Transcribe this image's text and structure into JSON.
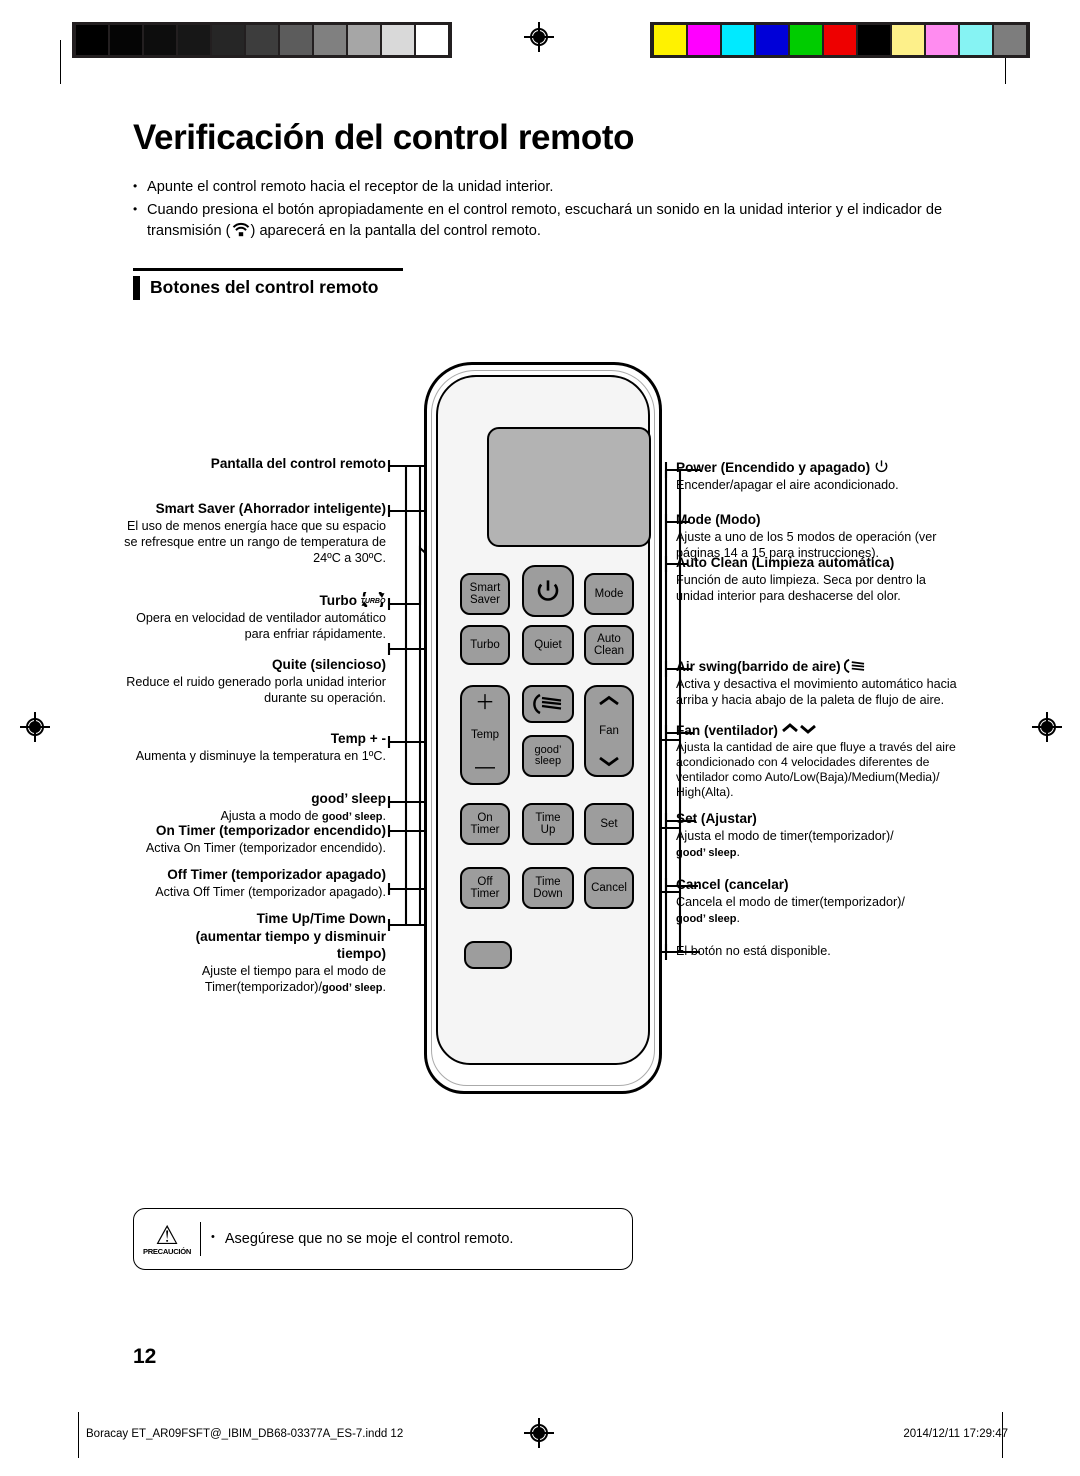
{
  "page": {
    "title": "Verificación del control remoto",
    "number": "12",
    "section_heading": "Botones del control remoto",
    "intro_bullets": [
      "Apunte el control remoto hacia el receptor de la unidad interior.",
      "Cuando presiona el botón apropiadamente en el control remoto, escuchará un sonido en la unidad interior y el indicador de transmisión (≋) aparecerá en la pantalla del control remoto."
    ],
    "intro_bullet_2_part1": "Cuando presiona el botón apropiadamente en el control remoto, escuchará un sonido en la unidad interior y el indicador de",
    "intro_bullet_2_part2": "transmisión (",
    "intro_bullet_2_part3": ") aparecerá en la pantalla del control remoto."
  },
  "calibration": {
    "gray_swatches": [
      "#000000",
      "#050505",
      "#0d0d0d",
      "#171717",
      "#262626",
      "#3d3d3d",
      "#5c5c5c",
      "#808080",
      "#a6a6a6",
      "#d9d9d9",
      "#ffffff"
    ],
    "color_swatches": [
      "#fff200",
      "#ff00ff",
      "#00eaff",
      "#0000d8",
      "#00cc00",
      "#ee0000",
      "#000000",
      "#fdf08a",
      "#ff8cf0",
      "#86f3f3",
      "#7d7d7d"
    ]
  },
  "remote": {
    "screen_label": "display",
    "buttons": [
      {
        "name": "smart-saver",
        "lines": [
          "Smart",
          "Saver"
        ]
      },
      {
        "name": "power",
        "lines": [],
        "glyph": "⏻"
      },
      {
        "name": "mode",
        "lines": [
          "Mode"
        ]
      },
      {
        "name": "turbo",
        "lines": [
          "Turbo"
        ]
      },
      {
        "name": "quiet",
        "lines": [
          "Quiet"
        ]
      },
      {
        "name": "auto-clean",
        "lines": [
          "Auto",
          "Clean"
        ]
      },
      {
        "name": "temp",
        "lines": [
          "Temp"
        ],
        "glyph_top": "＋",
        "glyph_bottom": "—"
      },
      {
        "name": "air-swing",
        "lines": []
      },
      {
        "name": "fan",
        "lines": [
          "Fan"
        ],
        "glyph_top": "⌃",
        "glyph_bottom": "⌄"
      },
      {
        "name": "good-sleep",
        "lines": [
          "good’",
          "sleep"
        ]
      },
      {
        "name": "on-timer",
        "lines": [
          "On",
          "Timer"
        ]
      },
      {
        "name": "time-up",
        "lines": [
          "Time",
          "Up"
        ]
      },
      {
        "name": "set",
        "lines": [
          "Set"
        ]
      },
      {
        "name": "off-timer",
        "lines": [
          "Off",
          "Timer"
        ]
      },
      {
        "name": "time-down",
        "lines": [
          "Time",
          "Down"
        ]
      },
      {
        "name": "cancel",
        "lines": [
          "Cancel"
        ]
      },
      {
        "name": "unavailable",
        "lines": []
      }
    ]
  },
  "left_callouts": {
    "display": {
      "heading": "Pantalla del control remoto",
      "body": ""
    },
    "smart_saver": {
      "heading": "Smart Saver (Ahorrador inteligente)",
      "body": "El uso de menos energía hace que su espacio se refresque entre un rango de temperatura de 24ºC a 30ºC."
    },
    "turbo": {
      "heading": "Turbo",
      "icon": "TURBO",
      "body": "Opera en velocidad de ventilador automático para enfriar rápidamente."
    },
    "quiet": {
      "heading": "Quite (silencioso)",
      "body": "Reduce el ruido generado porla unidad interior durante su operación."
    },
    "temp": {
      "heading": "Temp + -",
      "body": "Aumenta y disminuye la temperatura en 1ºC."
    },
    "good_sleep": {
      "heading": "good’ sleep",
      "body_pre": "Ajusta a modo de ",
      "body_bold": "good’ sleep",
      "body_post": "."
    },
    "on_timer": {
      "heading": "On Timer (temporizador encendido)",
      "body": "Activa On Timer (temporizador encendido)."
    },
    "off_timer": {
      "heading": "Off Timer (temporizador apagado)",
      "body": "Activa Off Timer (temporizador apagado)."
    },
    "time_updown": {
      "heading_l1": "Time Up/Time Down",
      "heading_l2": "(aumentar tiempo y disminuir",
      "heading_l3": "tiempo)",
      "body_l1": "Ajuste el tiempo para el modo de",
      "body_l2_pre": "Timer(temporizador)/",
      "body_l2_bold": "good’ sleep",
      "body_l2_post": "."
    }
  },
  "right_callouts": {
    "power": {
      "heading": "Power (Encendido y apagado)",
      "icon": "power-symbol",
      "body": "Encender/apagar el aire acondicionado."
    },
    "mode": {
      "heading": "Mode (Modo)",
      "body_l1": "Ajuste a uno de los 5 modos de operación (ver",
      "body_l2": "páginas 14 a 15 para instrucciones)."
    },
    "auto_clean": {
      "heading": "Auto Clean (Limpieza automática)",
      "body_l1": "Función de auto limpieza. Seca por dentro la",
      "body_l2": "unidad interior para deshacerse del olor."
    },
    "air_swing": {
      "heading": "Air swing(barrido de aire)",
      "icon": "air-swing-symbol",
      "body_l1": "Activa y desactiva el movimiento automático hacia",
      "body_l2": "arriba y hacia abajo de la paleta de flujo de aire."
    },
    "fan": {
      "heading": "Fan (ventilador)",
      "icon": "chevron-up-down",
      "body_l1": "Ajusta la cantidad de aire que fluye a través del aire",
      "body_l2": "acondicionado con 4 velocidades diferentes de",
      "body_l3": "ventilador como Auto/Low(Baja)/Medium(Media)/",
      "body_l4": "High(Alta)."
    },
    "set": {
      "heading": "Set (Ajustar)",
      "body_l1": "Ajusta el modo de timer(temporizador)/",
      "body_l2_bold": "good’ sleep",
      "body_l2_post": "."
    },
    "cancel": {
      "heading": "Cancel (cancelar)",
      "body_l1": "Cancela el modo de timer(temporizador)/",
      "body_l2_bold": "good’ sleep",
      "body_l2_post": "."
    },
    "unavailable": {
      "heading": "",
      "body": "El botón no está disponible."
    }
  },
  "caution": {
    "label": "PRECAUCIÓN",
    "text": "Asegúrese que no se moje el control remoto."
  },
  "footer": {
    "filename": "Boracay ET_AR09FSFT@_IBIM_DB68-03377A_ES-7.indd   12",
    "timestamp": "2014/12/11   17:29:47"
  }
}
